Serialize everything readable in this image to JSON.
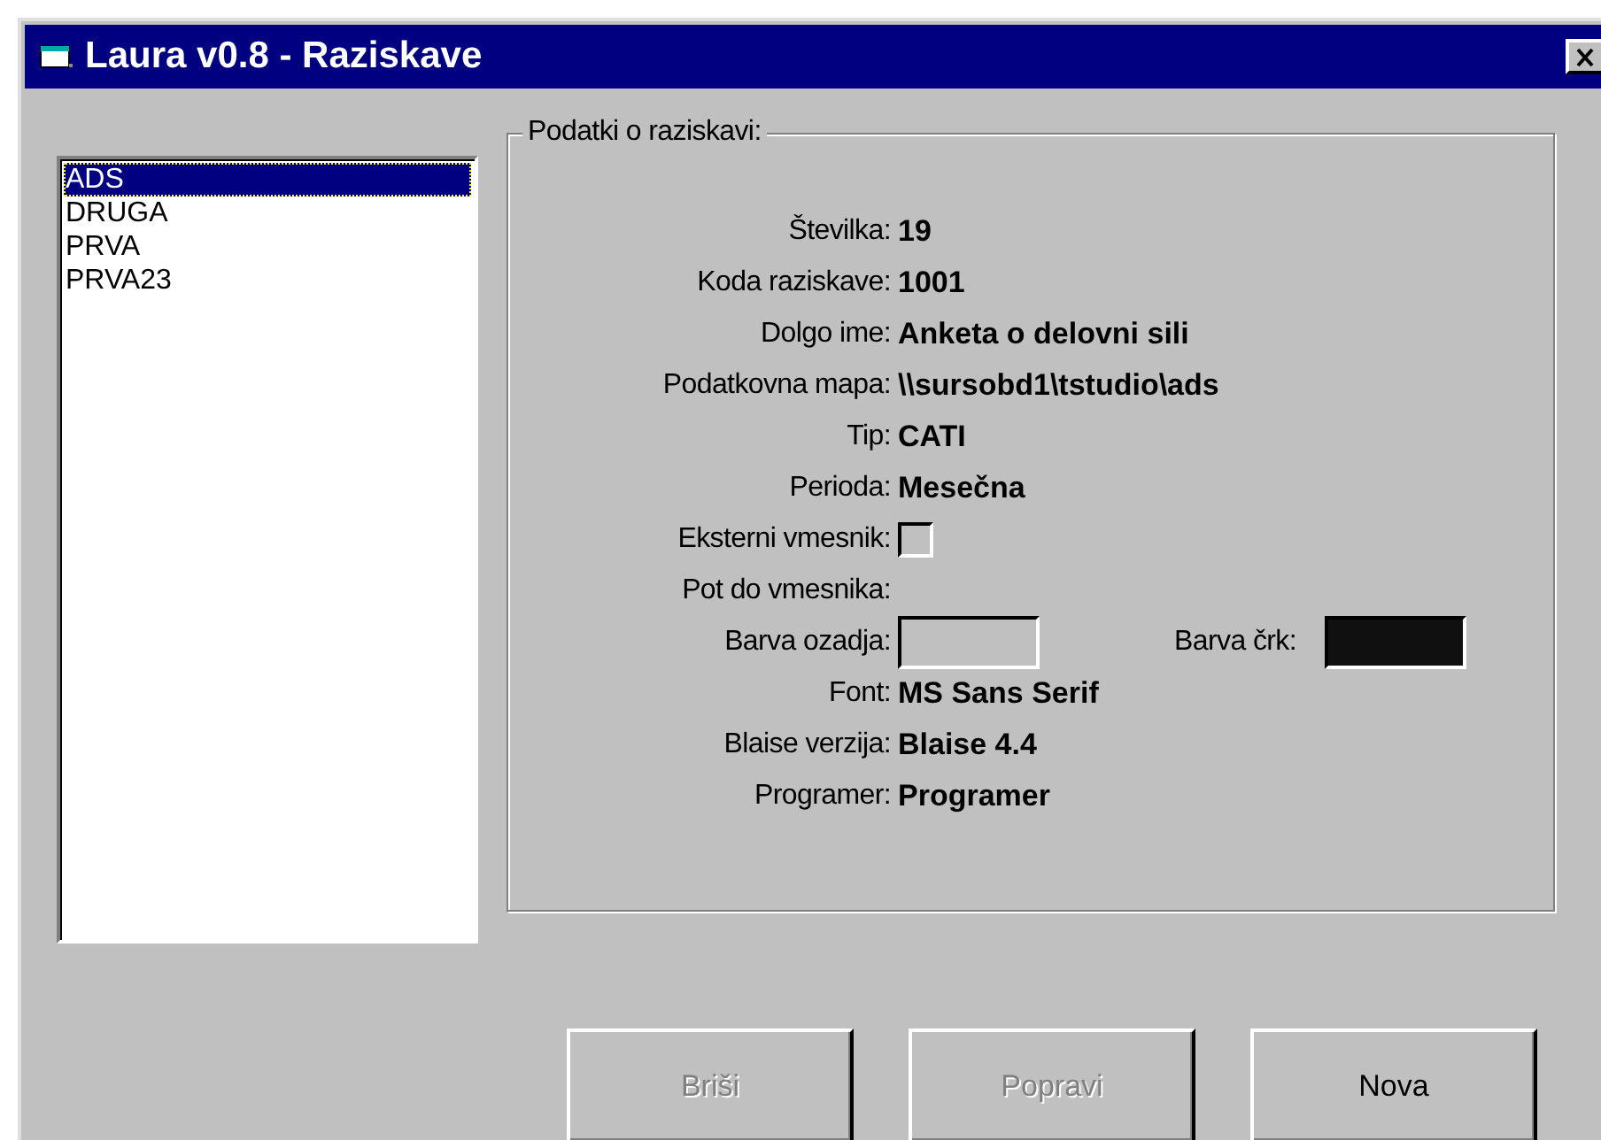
{
  "window": {
    "title": "Laura v0.8 - Raziskave"
  },
  "list": {
    "items": [
      {
        "label": "ADS",
        "selected": true
      },
      {
        "label": "DRUGA",
        "selected": false
      },
      {
        "label": "PRVA",
        "selected": false
      },
      {
        "label": "PRVA23",
        "selected": false
      }
    ]
  },
  "group": {
    "title": "Podatki o raziskavi:",
    "rows": [
      {
        "kind": "text",
        "label": "Številka:",
        "value": "19"
      },
      {
        "kind": "text",
        "label": "Koda raziskave:",
        "value": "1001"
      },
      {
        "kind": "text",
        "label": "Dolgo ime:",
        "value": "Anketa o delovni sili"
      },
      {
        "kind": "text",
        "label": "Podatkovna mapa:",
        "value": "\\\\sursobd1\\tstudio\\ads"
      },
      {
        "kind": "text",
        "label": "Tip:",
        "value": "CATI"
      },
      {
        "kind": "text",
        "label": "Perioda:",
        "value": "Mesečna"
      },
      {
        "kind": "checkbox",
        "label": "Eksterni vmesnik:",
        "checked": false
      },
      {
        "kind": "empty",
        "label": "Pot do vmesnika:"
      },
      {
        "kind": "colors",
        "label": "Barva ozadja:",
        "color": "#c0c0c0",
        "extra": {
          "label": "Barva črk:",
          "color": "#101010"
        }
      },
      {
        "kind": "text",
        "label": "Font:",
        "value": "MS Sans Serif"
      },
      {
        "kind": "text",
        "label": "Blaise verzija:",
        "value": "Blaise 4.4"
      },
      {
        "kind": "text",
        "label": "Programer:",
        "value": "Programer"
      }
    ]
  },
  "buttons": [
    {
      "label": "Briši",
      "disabled": true
    },
    {
      "label": "Popravi",
      "disabled": true
    },
    {
      "label": "Nova",
      "disabled": false
    }
  ]
}
